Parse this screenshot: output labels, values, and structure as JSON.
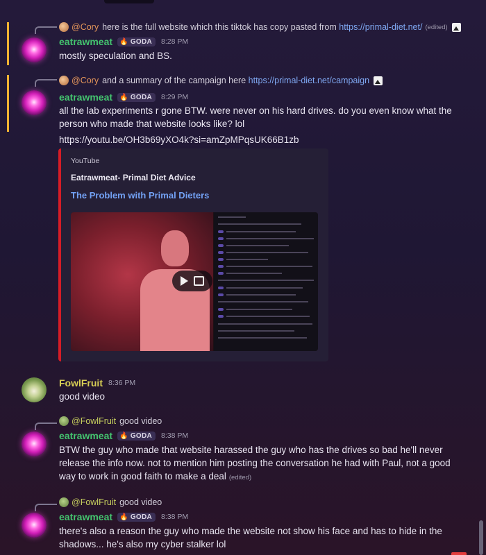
{
  "messages": {
    "m1": {
      "reply_author": "@Cory",
      "reply_text": "here is the full website which this tiktok has copy pasted from",
      "reply_link": "https://primal-diet.net/",
      "reply_edited": "(edited)",
      "author": "eatrawmeat",
      "tag": "GODA",
      "time": "8:28 PM",
      "text": "mostly speculation and BS."
    },
    "m2": {
      "reply_author": "@Cory",
      "reply_text": "and a summary of the campaign here",
      "reply_link": "https://primal-diet.net/campaign",
      "author": "eatrawmeat",
      "tag": "GODA",
      "time": "8:29 PM",
      "text": "all the lab experiments r gone BTW. were never on his hard drives.  do you even know what the person who made that website looks like? lol",
      "link": "https://youtu.be/OH3b69yXO4k?si=amZpMPqsUK66B1zb",
      "embed": {
        "provider": "YouTube",
        "author": "Eatrawmeat- Primal Diet Advice",
        "title": "The Problem with Primal Dieters"
      }
    },
    "m3": {
      "author": "FowlFruit",
      "time": "8:36 PM",
      "text": "good video"
    },
    "m4": {
      "reply_author": "@FowlFruit",
      "reply_text": "good video",
      "author": "eatrawmeat",
      "tag": "GODA",
      "time": "8:38 PM",
      "text": "BTW the guy who made that website harassed the guy who has the drives so bad he'll never release the info now. not to mention him posting the conversation  he had with Paul, not a good way to work in good faith to make a deal",
      "edited": "(edited)"
    },
    "m5": {
      "reply_author": "@FowlFruit",
      "reply_text": "good video",
      "author": "eatrawmeat",
      "tag": "GODA",
      "time": "8:38 PM",
      "text": "there's also a reason the guy who made the website not show his face and has to hide in the shadows... he's also my cyber stalker lol"
    }
  },
  "colors": {
    "mention_highlight": "#f0b232",
    "link": "#7fa8f2",
    "username_eatrawmeat": "#44c46f",
    "username_fowlfruit": "#d8cf55",
    "embed_border": "#d51c26"
  }
}
